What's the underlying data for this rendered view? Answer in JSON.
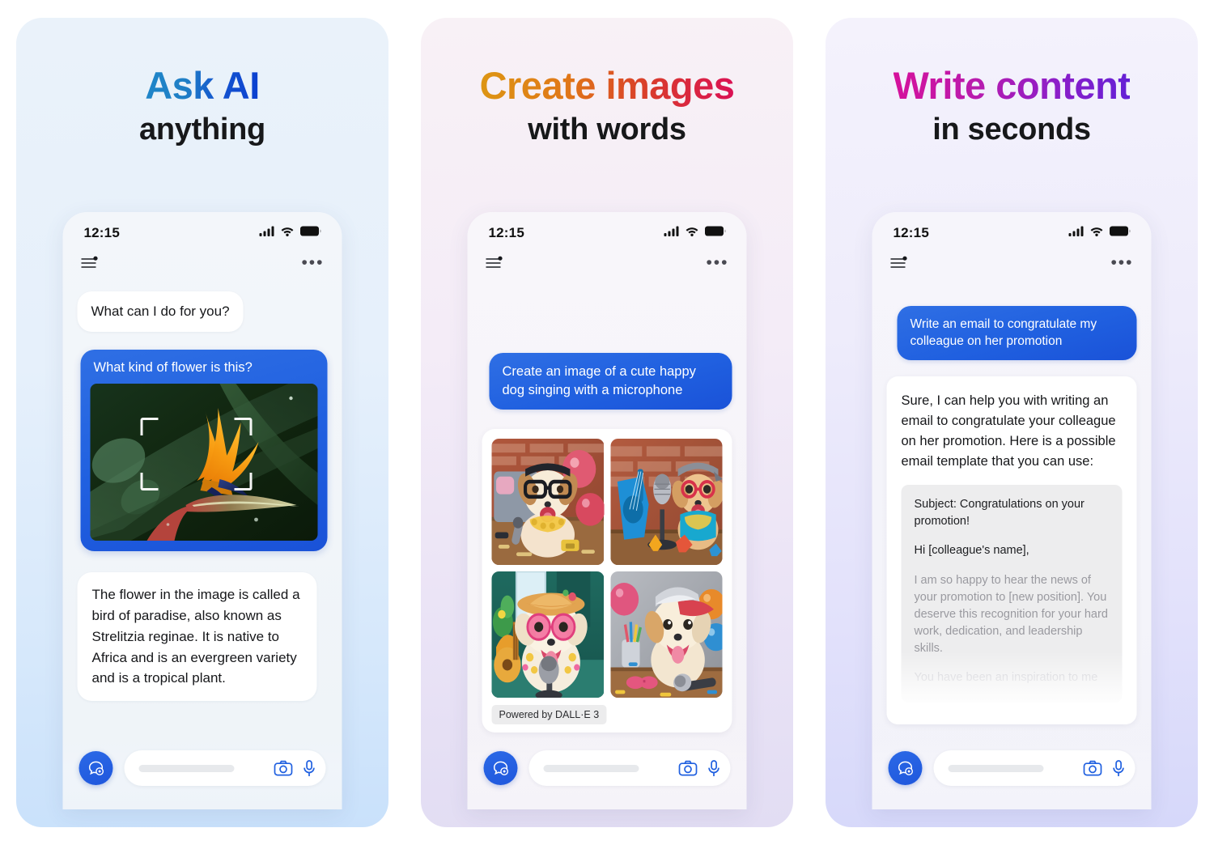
{
  "panels": [
    {
      "headline_top": "Ask AI",
      "headline_bottom": "anything",
      "accent_from": "#1f86c8",
      "accent_to": "#0b3fd0",
      "status": {
        "time": "12:15"
      },
      "messages": {
        "bot_greeting": "What can I do for you?",
        "user_caption": "What kind of flower is this?",
        "bot_answer": "The flower in the image is called a bird of paradise, also known as Strelitzia reginae. It is native to Africa and is an evergreen variety and is a tropical plant."
      },
      "input": {
        "placeholder": ""
      }
    },
    {
      "headline_top": "Create images",
      "headline_bottom": "with words",
      "accent_from": "#dd9613",
      "accent_to": "#da1055",
      "status": {
        "time": "12:15"
      },
      "messages": {
        "user_prompt": "Create an image of a cute happy dog singing with a microphone",
        "powered_by": "Powered by DALL·E 3"
      },
      "input": {
        "placeholder": ""
      }
    },
    {
      "headline_top": "Write content",
      "headline_bottom": "in seconds",
      "accent_from": "#d6119b",
      "accent_to": "#6320d6",
      "status": {
        "time": "12:15"
      },
      "messages": {
        "user_prompt": "Write an email to congratulate my colleague on her promotion",
        "bot_intro": "Sure, I can help you with writing an email to congratulate your colleague on her promotion. Here is a possible email template that you can use:",
        "email": {
          "subject": "Subject: Congratulations on your promotion!",
          "salutation": "Hi [colleague's name],",
          "body": "I am so happy to hear the news of your promotion to [new position]. You deserve this recognition for your hard work, dedication, and leadership skills.",
          "body_faded": "You have been an inspiration to me"
        }
      },
      "input": {
        "placeholder": ""
      }
    }
  ],
  "icons": {
    "signal": "signal-bars-icon",
    "wifi": "wifi-icon",
    "battery": "battery-full-icon",
    "menu": "list-settings-icon",
    "more": "more-options-icon",
    "chat": "chat-assistant-icon",
    "camera": "camera-icon",
    "mic": "microphone-icon"
  },
  "theme": {
    "user_bubble": "#2060e0",
    "bot_bubble": "#ffffff",
    "fab": "#1f57dd",
    "text_primary": "#16171a"
  }
}
